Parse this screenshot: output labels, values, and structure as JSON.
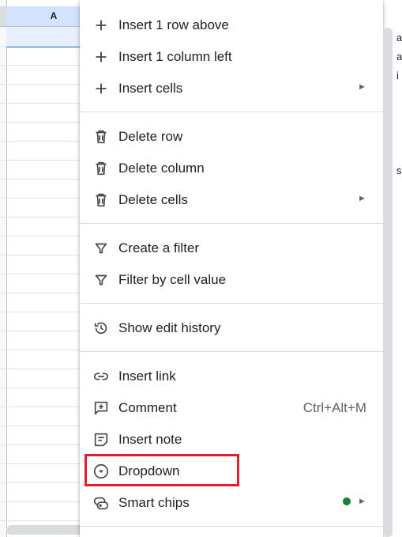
{
  "sheet": {
    "column_header": "A",
    "edge_chars": [
      "a",
      "a",
      "i",
      "s"
    ]
  },
  "menu": {
    "items": [
      {
        "label": "Insert 1 row above",
        "icon": "plus-icon"
      },
      {
        "label": "Insert 1 column left",
        "icon": "plus-icon"
      },
      {
        "label": "Insert cells",
        "icon": "plus-icon",
        "submenu": true
      },
      {
        "label": "Delete row",
        "icon": "trash-icon"
      },
      {
        "label": "Delete column",
        "icon": "trash-icon"
      },
      {
        "label": "Delete cells",
        "icon": "trash-icon",
        "submenu": true
      },
      {
        "label": "Create a filter",
        "icon": "filter-icon"
      },
      {
        "label": "Filter by cell value",
        "icon": "filter-icon"
      },
      {
        "label": "Show edit history",
        "icon": "history-icon"
      },
      {
        "label": "Insert link",
        "icon": "link-icon"
      },
      {
        "label": "Comment",
        "icon": "comment-icon",
        "shortcut": "Ctrl+Alt+M"
      },
      {
        "label": "Insert note",
        "icon": "note-icon"
      },
      {
        "label": "Dropdown",
        "icon": "dropdown-icon",
        "highlighted": true
      },
      {
        "label": "Smart chips",
        "icon": "smart-chips-icon",
        "submenu": true,
        "new_badge": true
      }
    ]
  },
  "colors": {
    "highlight": "#e0202b",
    "new_badge": "#188038",
    "selected_column": "#d3e3fd"
  }
}
